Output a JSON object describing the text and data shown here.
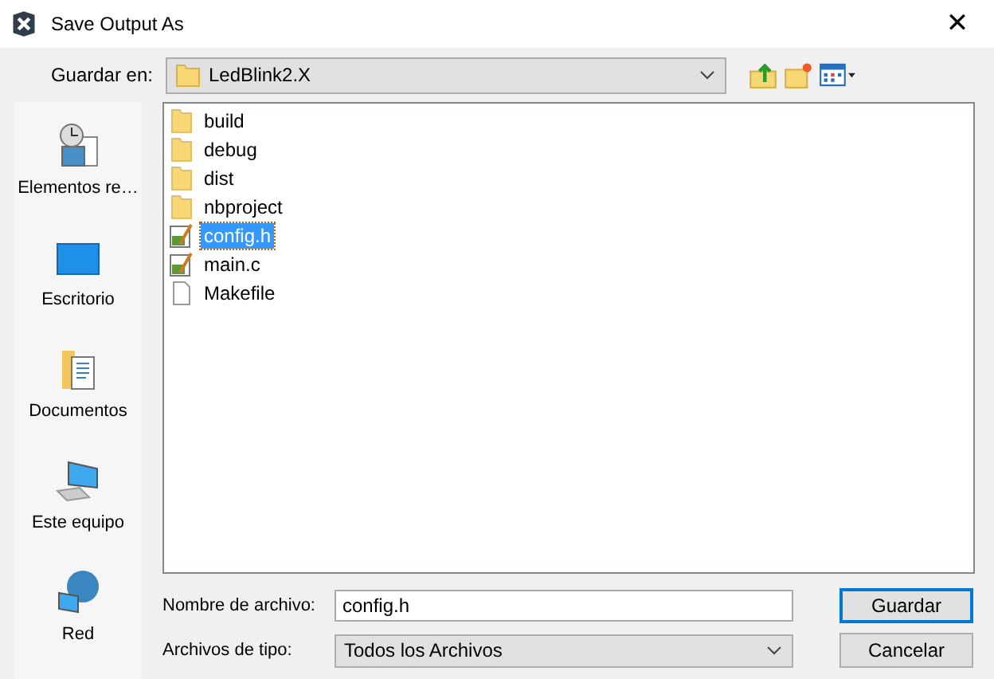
{
  "window": {
    "title": "Save Output As",
    "close": "✕"
  },
  "location": {
    "label": "Guardar en:",
    "value": "LedBlink2.X"
  },
  "sidebar": {
    "items": [
      {
        "kind": "recent",
        "label": "Elementos re…"
      },
      {
        "kind": "desktop",
        "label": "Escritorio"
      },
      {
        "kind": "documents",
        "label": "Documentos"
      },
      {
        "kind": "computer",
        "label": "Este equipo"
      },
      {
        "kind": "network",
        "label": "Red"
      }
    ]
  },
  "files": [
    {
      "kind": "folder",
      "name": "build",
      "selected": false
    },
    {
      "kind": "folder",
      "name": "debug",
      "selected": false
    },
    {
      "kind": "folder",
      "name": "dist",
      "selected": false
    },
    {
      "kind": "folder",
      "name": "nbproject",
      "selected": false
    },
    {
      "kind": "source",
      "name": "config.h",
      "selected": true
    },
    {
      "kind": "source",
      "name": "main.c",
      "selected": false
    },
    {
      "kind": "file",
      "name": "Makefile",
      "selected": false
    }
  ],
  "filename": {
    "label": "Nombre de archivo:",
    "value": "config.h"
  },
  "filetype": {
    "label": "Archivos de tipo:",
    "value": "Todos los Archivos"
  },
  "buttons": [
    {
      "label": "Guardar",
      "default": true
    },
    {
      "label": "Cancelar",
      "default": false
    }
  ]
}
